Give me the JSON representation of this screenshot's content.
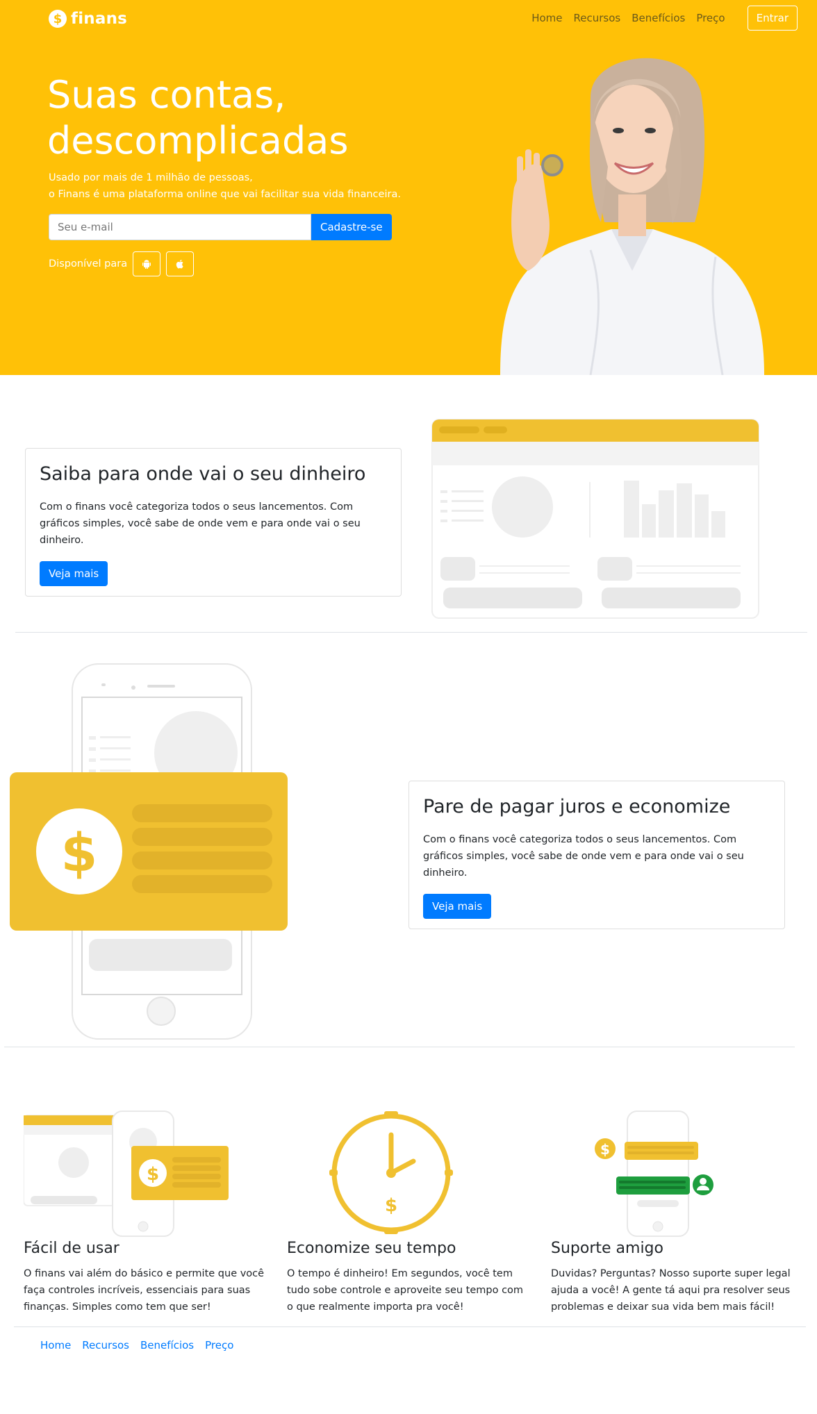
{
  "header": {
    "brand": "finans",
    "brand_icon": "dollar-coin-icon",
    "nav": [
      "Home",
      "Recursos",
      "Benefícios",
      "Preço"
    ],
    "login_label": "Entrar"
  },
  "hero": {
    "title": "Suas contas, descomplicadas",
    "subtitle_line1": "Usado por mais de 1 milhão de pessoas,",
    "subtitle_line2": "o Finans é uma plataforma online que vai facilitar sua vida financeira.",
    "email_placeholder": "Seu e-mail",
    "signup_label": "Cadastre-se",
    "available_label": "Disponível para",
    "platform_icons": [
      "android-icon",
      "apple-icon"
    ]
  },
  "features": [
    {
      "title": "Saiba para onde vai o seu dinheiro",
      "text": "Com o finans você categoriza todos o seus lancementos. Com gráficos simples, você sabe de onde vem e para onde vai o seu dinheiro.",
      "button": "Veja mais"
    },
    {
      "title": "Pare de pagar juros e economize",
      "text": "Com o finans você categoriza todos o seus lancementos. Com gráficos simples, você sabe de onde vem e para onde vai o seu dinheiro.",
      "button": "Veja mais"
    }
  ],
  "benefits": [
    {
      "title": "Fácil de usar",
      "text": "O finans vai além do básico e permite que você faça controles incríveis, essenciais para suas finanças. Simples como tem que ser!"
    },
    {
      "title": "Economize seu tempo",
      "text": "O tempo é dinheiro! Em segundos, você tem tudo sobe controle e aproveite seu tempo com o que realmente importa pra você!"
    },
    {
      "title": "Suporte amigo",
      "text": "Duvidas? Perguntas? Nosso suporte super legal ajuda a você! A gente tá aqui pra resolver seus problemas e deixar sua vida bem mais fácil!"
    }
  ],
  "footer": {
    "nav": [
      "Home",
      "Recursos",
      "Benefícios",
      "Preço"
    ]
  },
  "colors": {
    "brand_yellow": "#ffc107",
    "illustration_yellow": "#f0c030",
    "primary_blue": "#007bff",
    "support_green": "#1e9e3e"
  }
}
